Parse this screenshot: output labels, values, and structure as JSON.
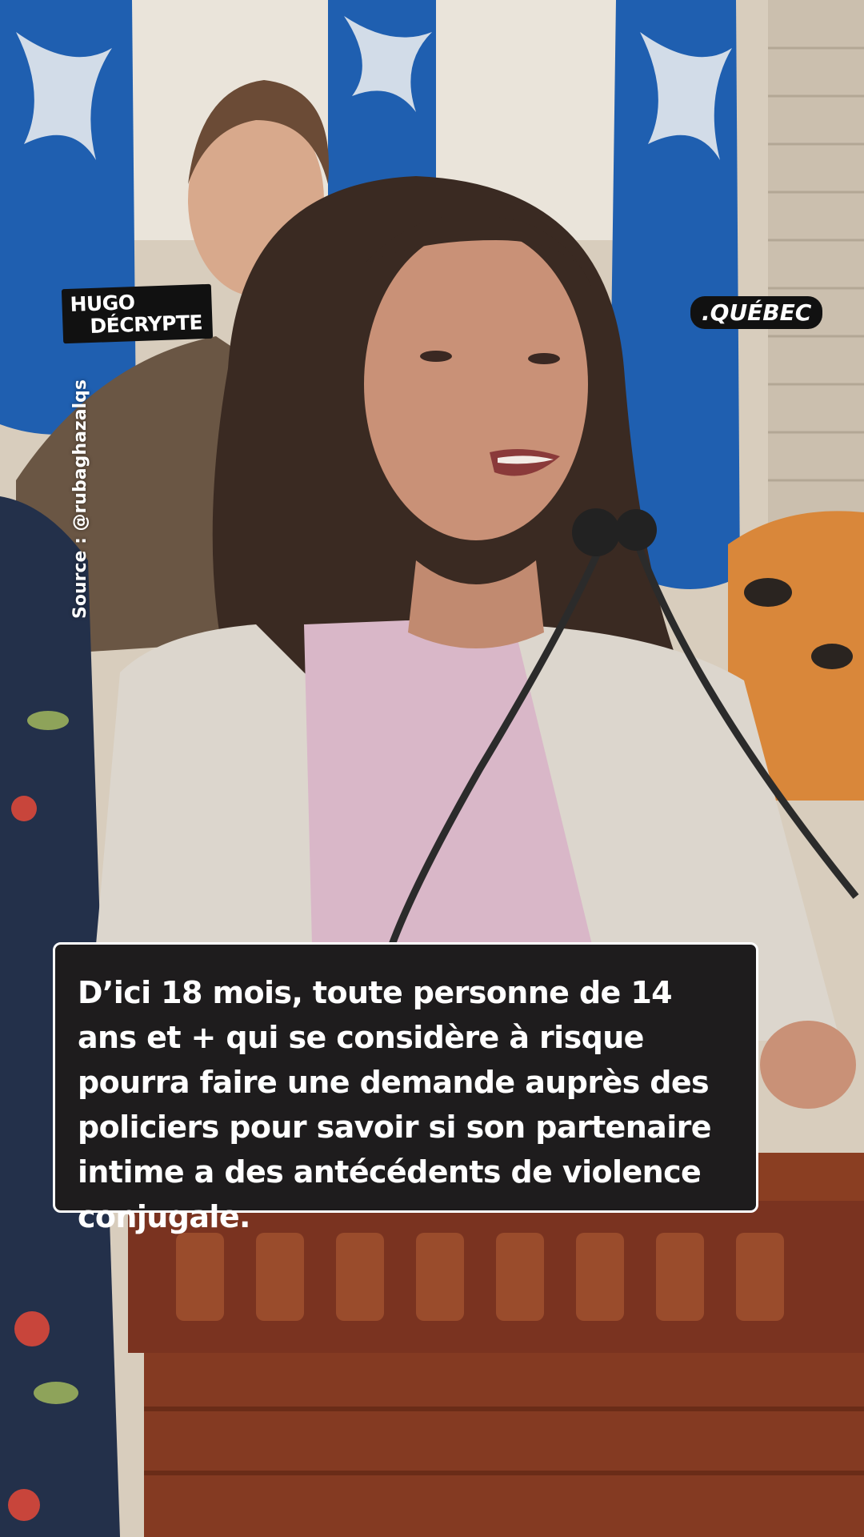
{
  "overlay": {
    "brand_line1": "HUGO",
    "brand_line2": "DÉCRYPTE",
    "region_label": ".QUÉBEC",
    "source_credit": "Source : @rubaghazalqs"
  },
  "caption": {
    "text": "D’ici 18 mois, toute personne de 14 ans et + qui se considère à risque pourra faire une demande auprès des policiers pour savoir si son partenaire intime a des antécédents de violence conjugale."
  },
  "colors": {
    "flag_blue": "#1f5fb0",
    "blazer": "#dcd6cd",
    "blouse": "#d9b7c8",
    "podium_wood": "#8a3e22",
    "caption_bg": "#1e1c1d"
  }
}
